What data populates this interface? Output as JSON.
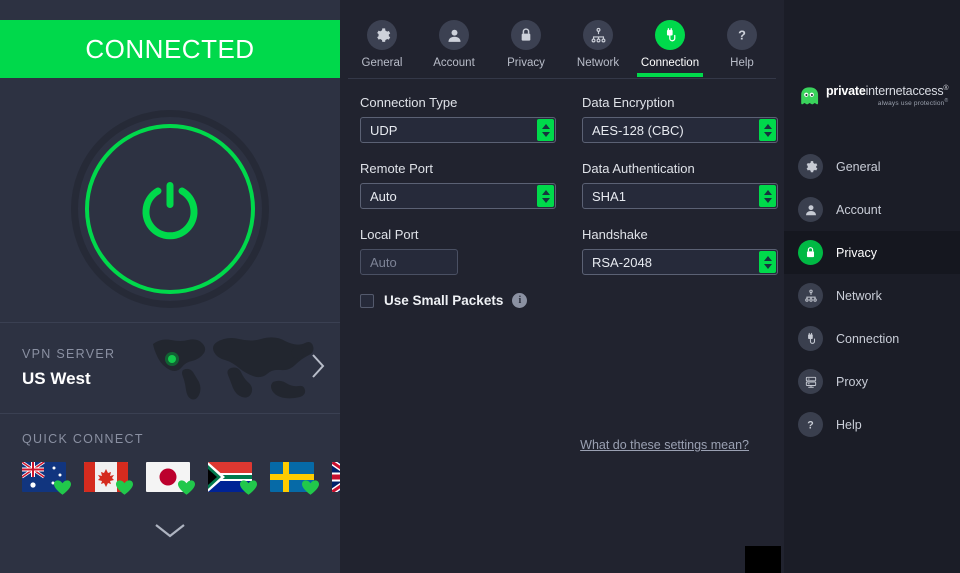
{
  "connection_panel": {
    "status_text": "CONNECTED",
    "status_color": "#00d94b",
    "power_button_name": "power-toggle",
    "server": {
      "label": "VPN SERVER",
      "name": "US West"
    },
    "quick_connect": {
      "label": "QUICK CONNECT",
      "flags": [
        {
          "country": "Australia",
          "icon": "flag-australia",
          "badge": "heart-icon"
        },
        {
          "country": "Canada",
          "icon": "flag-canada",
          "badge": "heart-icon"
        },
        {
          "country": "Japan",
          "icon": "flag-japan",
          "badge": "heart-icon"
        },
        {
          "country": "South Africa",
          "icon": "flag-south-africa",
          "badge": "heart-icon"
        },
        {
          "country": "Sweden",
          "icon": "flag-sweden",
          "badge": "heart-icon"
        },
        {
          "country": "United Kingdom",
          "icon": "flag-united-kingdom",
          "badge": "heart-icon"
        }
      ]
    },
    "collapse_icon": "chevron-down-icon",
    "server_arrow_icon": "chevron-right-icon"
  },
  "tabs": [
    {
      "label": "General",
      "icon": "gear-icon",
      "active": false
    },
    {
      "label": "Account",
      "icon": "person-icon",
      "active": false
    },
    {
      "label": "Privacy",
      "icon": "lock-icon",
      "active": false
    },
    {
      "label": "Network",
      "icon": "network-icon",
      "active": false
    },
    {
      "label": "Connection",
      "icon": "plug-icon",
      "active": true
    },
    {
      "label": "Help",
      "icon": "question-icon",
      "active": false
    }
  ],
  "settings": {
    "left_column": [
      {
        "label": "Connection Type",
        "value": "UDP",
        "control": "dropdown"
      },
      {
        "label": "Remote Port",
        "value": "Auto",
        "control": "dropdown"
      },
      {
        "label": "Local Port",
        "value": "",
        "placeholder": "Auto",
        "control": "textbox"
      }
    ],
    "right_column": [
      {
        "label": "Data Encryption",
        "value": "AES-128 (CBC)",
        "control": "dropdown"
      },
      {
        "label": "Data Authentication",
        "value": "SHA1",
        "control": "dropdown"
      },
      {
        "label": "Handshake",
        "value": "RSA-2048",
        "control": "dropdown"
      }
    ],
    "checkbox": {
      "label": "Use Small Packets",
      "checked": false,
      "info_icon": "info-icon",
      "info_glyph": "i"
    },
    "help_link": "What do these settings mean?"
  },
  "sidebar": {
    "brand": {
      "name_bold": "private",
      "name_rest": "internetaccess",
      "registered": "®",
      "tagline": "always use protection",
      "logo_icon": "pia-robot-icon"
    },
    "items": [
      {
        "label": "General",
        "icon": "gear-icon",
        "active": false
      },
      {
        "label": "Account",
        "icon": "person-icon",
        "active": false
      },
      {
        "label": "Privacy",
        "icon": "lock-icon",
        "active": true
      },
      {
        "label": "Network",
        "icon": "network-icon",
        "active": false
      },
      {
        "label": "Connection",
        "icon": "plug-icon",
        "active": false
      },
      {
        "label": "Proxy",
        "icon": "proxy-icon",
        "active": false
      },
      {
        "label": "Help",
        "icon": "question-icon",
        "active": false
      }
    ]
  },
  "theme": {
    "accent_green": "#00d94b",
    "left_panel_bg": "#2d3242",
    "main_bg": "#21232f",
    "sidebar_bg": "#1b1d27"
  }
}
